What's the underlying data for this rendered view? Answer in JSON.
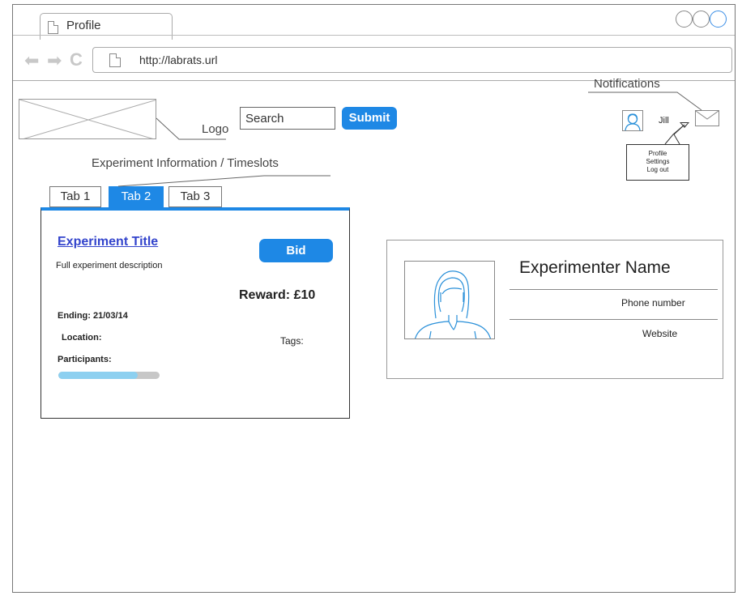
{
  "browser": {
    "tab_title": "Profile",
    "url": "http://labrats.url"
  },
  "header": {
    "logo_label": "Logo",
    "search_placeholder": "Search",
    "submit_label": "Submit",
    "notifications_label": "Notifications",
    "user_name": "Jill",
    "user_menu": [
      "Profile",
      "Settings",
      "Log out"
    ]
  },
  "section_label": "Experiment Information / Timeslots",
  "tabs": [
    {
      "label": "Tab 1",
      "active": false
    },
    {
      "label": "Tab 2",
      "active": true
    },
    {
      "label": "Tab 3",
      "active": false
    }
  ],
  "experiment": {
    "title": "Experiment Title",
    "description": "Full experiment description",
    "bid_label": "Bid",
    "reward": "Reward: £10",
    "ending": "Ending: 21/03/14",
    "location": "Location:",
    "tags": "Tags:",
    "participants": "Participants:",
    "participants_progress": 0.78
  },
  "experimenter": {
    "name": "Experimenter Name",
    "phone": "Phone number",
    "website": "Website"
  },
  "colors": {
    "accent": "#1e88e5",
    "progress_fill": "#8dd0f0",
    "progress_track": "#c7c7c7",
    "link": "#3344cc"
  },
  "icons": [
    "document-icon",
    "back-arrow-icon",
    "forward-arrow-icon",
    "refresh-icon",
    "user-avatar-icon",
    "chevron-down-icon",
    "mail-icon",
    "window-button-icon"
  ]
}
